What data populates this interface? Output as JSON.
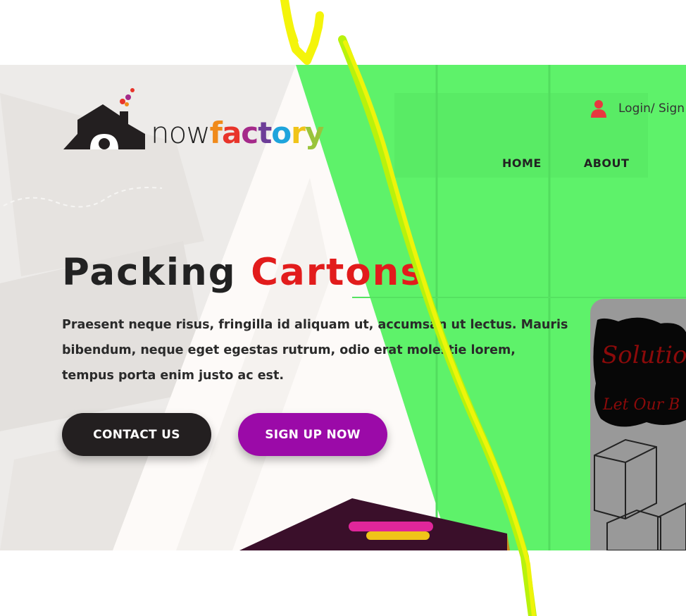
{
  "header": {
    "logo": {
      "word_now": "now",
      "word_factory_letters": [
        "f",
        "a",
        "c",
        "t",
        "o",
        "r",
        "y"
      ],
      "letter_colors": [
        "#f08a1a",
        "#e8342a",
        "#a52a8a",
        "#6d3d98",
        "#1ea4dc",
        "#f0c419",
        "#9ac43b"
      ]
    },
    "login_label": "Login/ Sign"
  },
  "nav": {
    "items": [
      "HOME",
      "ABOUT"
    ]
  },
  "hero": {
    "title_part1": "Packing",
    "title_part2": "Cartons",
    "description": "Praesent neque risus, fringilla id aliquam ut, accumsan ut lectus. Mauris bibendum, neque eget egestas rutrum, odio erat molestie lorem, tempus porta enim justo ac est.",
    "contact_button": "CONTACT US",
    "signup_button": "SIGN UP NOW"
  },
  "side_card": {
    "line1": "Solutio",
    "line2": "Let Our B"
  },
  "colors": {
    "accent_red": "#e21c1c",
    "signup_purple": "#9b0aa8",
    "contact_dark": "#231f20",
    "green_overlay": "#5ef26a",
    "scribble_yellow": "#f4f40a"
  }
}
